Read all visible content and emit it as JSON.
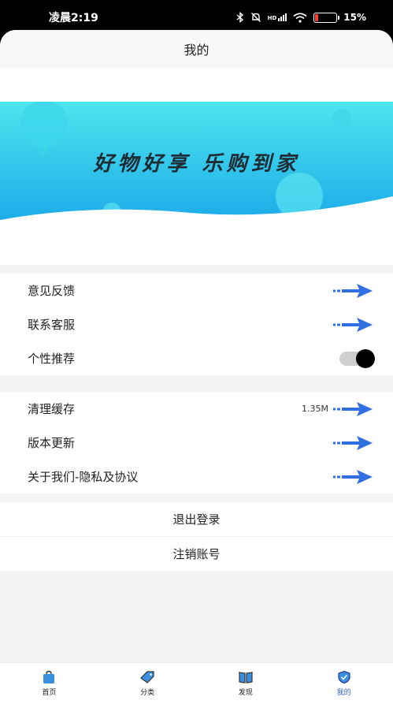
{
  "status_bar": {
    "time": "凌晨2:19",
    "battery": "15%",
    "battery_level": 0.15,
    "hd_label": "HD"
  },
  "header": {
    "title": "我的"
  },
  "banner": {
    "slogan": "好物好享 乐购到家"
  },
  "settings": {
    "feedback_label": "意见反馈",
    "customer_service_label": "联系客服",
    "personal_recommend_label": "个性推荐",
    "personal_recommend_on": true,
    "clear_cache_label": "清理缓存",
    "cache_size": "1.35M",
    "version_update_label": "版本更新",
    "about_label": "关于我们-隐私及协议"
  },
  "actions": {
    "logout_label": "退出登录",
    "cancel_account_label": "注销账号"
  },
  "tabbar": {
    "home": "首页",
    "category": "分类",
    "discover": "发现",
    "mine": "我的",
    "active_color": "#3a5bd6"
  },
  "colors": {
    "arrow": "#2f6fe0",
    "banner_top": "#4de6ee",
    "banner_bottom": "#1aa8e8"
  }
}
